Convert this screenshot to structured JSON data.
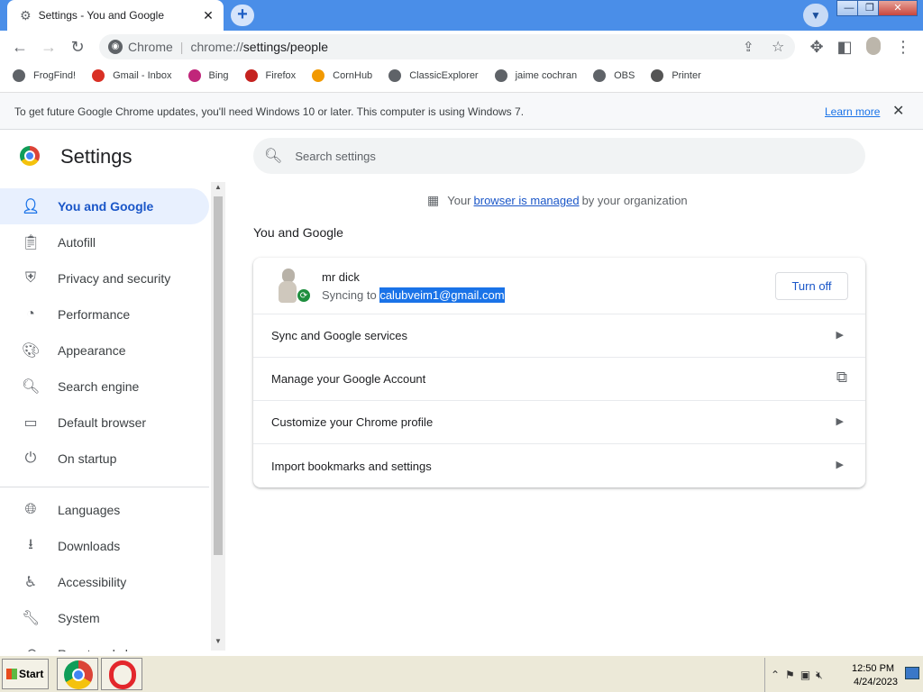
{
  "browser": {
    "tab_title": "Settings - You and Google",
    "tab_close": "✕",
    "new_tab": "+",
    "omnibox_label": "Chrome",
    "url_scheme": "chrome://",
    "url_path": "settings/people"
  },
  "bookmarks": [
    {
      "label": "FrogFind!",
      "icon": "globe-icon",
      "color": "#5f6368"
    },
    {
      "label": "Gmail - Inbox",
      "icon": "gmail-icon",
      "color": "#d93025"
    },
    {
      "label": "Bing",
      "icon": "sky-icon",
      "color": "#c0267a"
    },
    {
      "label": "Firefox",
      "icon": "firefox-icon",
      "color": "#c5221f"
    },
    {
      "label": "CornHub",
      "icon": "ch-icon",
      "color": "#f29900"
    },
    {
      "label": "ClassicExplorer",
      "icon": "globe-icon",
      "color": "#5f6368"
    },
    {
      "label": "jaime cochran",
      "icon": "globe-icon",
      "color": "#5f6368"
    },
    {
      "label": "OBS",
      "icon": "globe-icon",
      "color": "#5f6368"
    },
    {
      "label": "Printer",
      "icon": "cups-icon",
      "color": "#555555"
    }
  ],
  "infobar": {
    "message": "To get future Google Chrome updates, you'll need Windows 10 or later. This computer is using Windows 7.",
    "learn_more": "Learn more"
  },
  "settings": {
    "title": "Settings",
    "search_placeholder": "Search settings",
    "nav": [
      {
        "label": "You and Google",
        "icon": "person-icon",
        "active": true
      },
      {
        "label": "Autofill",
        "icon": "clipboard-icon"
      },
      {
        "label": "Privacy and security",
        "icon": "shield-icon"
      },
      {
        "label": "Performance",
        "icon": "gauge-icon"
      },
      {
        "label": "Appearance",
        "icon": "palette-icon"
      },
      {
        "label": "Search engine",
        "icon": "search-icon"
      },
      {
        "label": "Default browser",
        "icon": "browser-icon"
      },
      {
        "label": "On startup",
        "icon": "power-icon"
      },
      {
        "label": "Languages",
        "icon": "globe-icon"
      },
      {
        "label": "Downloads",
        "icon": "download-icon"
      },
      {
        "label": "Accessibility",
        "icon": "accessibility-icon"
      },
      {
        "label": "System",
        "icon": "wrench-icon"
      },
      {
        "label": "Reset and clean up",
        "icon": "reset-icon"
      }
    ],
    "managed": {
      "prefix": "Your",
      "link": "browser is managed",
      "suffix": "by your organization"
    },
    "section_title": "You and Google",
    "profile": {
      "name": "mr dick",
      "sync_prefix": "Syncing to",
      "email": "calubveim1@gmail.com",
      "turn_off": "Turn off"
    },
    "rows": [
      {
        "label": "Sync and Google services",
        "trail": "arrow"
      },
      {
        "label": "Manage your Google Account",
        "trail": "external"
      },
      {
        "label": "Customize your Chrome profile",
        "trail": "arrow"
      },
      {
        "label": "Import bookmarks and settings",
        "trail": "arrow"
      }
    ]
  },
  "taskbar": {
    "start": "Start",
    "time": "12:50 PM",
    "date": "4/24/2023"
  },
  "colors": {
    "accent": "#1a73e8",
    "titlebar": "#4a8ee8",
    "active_nav_bg": "#e8f0fe"
  }
}
